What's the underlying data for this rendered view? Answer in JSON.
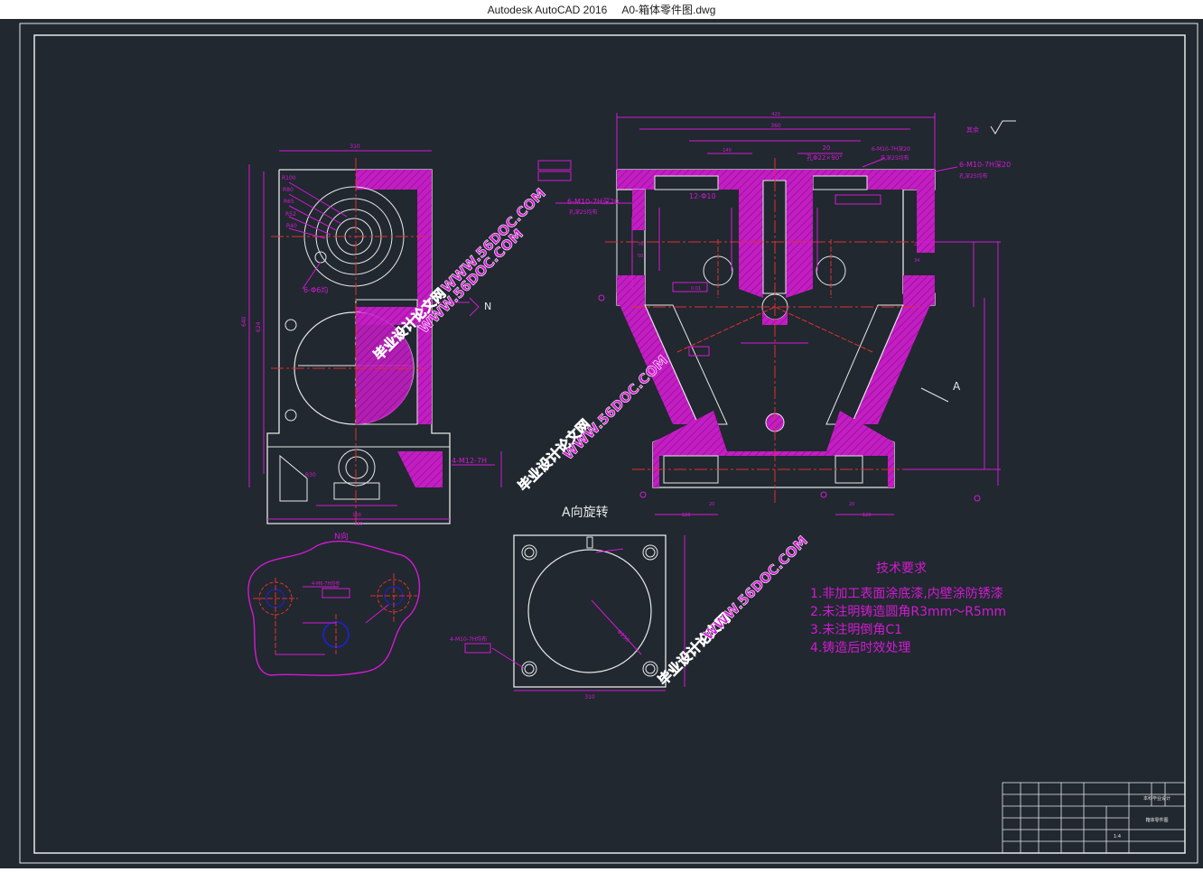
{
  "window": {
    "app_name": "Autodesk AutoCAD 2016",
    "file_name": "A0-箱体零件图.dwg"
  },
  "colors": {
    "background": "#212830",
    "line_white": "#e8e8e8",
    "line_magenta": "#d21ad2",
    "hatch_magenta": "#c41dc4",
    "center_red": "#e03030",
    "blue": "#2020e0"
  },
  "drawing": {
    "left_view": {
      "width_dim": "310",
      "height_dims": [
        "640",
        "624"
      ],
      "radius_labels": [
        "R100",
        "R80",
        "R65",
        "R52",
        "R40"
      ],
      "hole_note": "6-Φ6均",
      "thread_note": "4-M12-7H",
      "bottom_dims": [
        "160",
        "380"
      ],
      "section_mark": "N",
      "view_caption": "N向",
      "radius_note": "R30"
    },
    "front_view": {
      "top_dims": [
        "420",
        "360",
        "140",
        "20"
      ],
      "hole_note_1": "孔Φ22×90°",
      "thread_top_right": "6-M10-7H深20",
      "thread_top_right_2": "孔深25均布",
      "thread_right": "6-M10-7H深20",
      "thread_right_2": "孔深25均布",
      "thread_left": "6-M10-7H深20",
      "thread_left_2": "孔深25均布",
      "dim_12": "12-Φ10",
      "side_dims": [
        "76",
        "50",
        "20",
        "34"
      ],
      "bottom_dims": [
        "120",
        "20",
        "20",
        "120"
      ],
      "tol_value": "0.01",
      "view_a": "A",
      "roughness": "其余"
    },
    "a_view": {
      "caption": "A向旋转",
      "width_dim": "310",
      "thread_note": "4-M10-7H均布",
      "dia_label": "Φ250"
    },
    "detail_view": {
      "note": "4-M6-7H均布"
    },
    "tech": {
      "title": "技术要求",
      "items": [
        "1.非加工表面涂底漆,内壁涂防锈漆",
        "2.未注明铸造圆角R3mm～R5mm",
        "3.未注明倒角C1",
        "4.铸造后时效处理"
      ]
    },
    "watermarks": [
      "毕业设计论文网",
      "WWW.56DOC.COM"
    ],
    "title_block": {
      "scale": "1:4",
      "school": "本科毕业设计",
      "part": "箱体零件图"
    }
  }
}
